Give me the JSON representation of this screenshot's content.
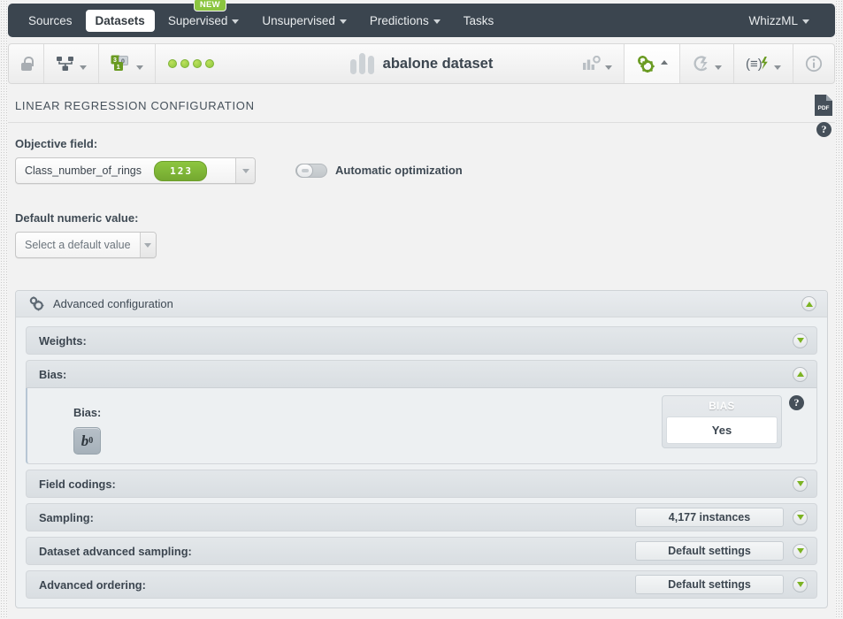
{
  "nav": {
    "items": [
      {
        "label": "Sources",
        "dropdown": false,
        "active": false
      },
      {
        "label": "Datasets",
        "dropdown": false,
        "active": true
      },
      {
        "label": "Supervised",
        "dropdown": true,
        "active": false,
        "badge": "NEW"
      },
      {
        "label": "Unsupervised",
        "dropdown": true,
        "active": false
      },
      {
        "label": "Predictions",
        "dropdown": true,
        "active": false
      },
      {
        "label": "Tasks",
        "dropdown": false,
        "active": false
      }
    ],
    "account": {
      "label": "WhizzML",
      "dropdown": true
    }
  },
  "resource_bar": {
    "title": "abalone dataset",
    "lock_icon": "lock-icon",
    "left_tools": [
      {
        "name": "dataset-tree-icon",
        "dropdown": true
      },
      {
        "name": "field-counts-icon",
        "dropdown": true,
        "counts": [
          "3",
          "0",
          "1"
        ]
      }
    ],
    "status_dots": 4,
    "right_tools": [
      {
        "name": "chart-config-icon",
        "dropdown": true,
        "active": false
      },
      {
        "name": "gears-icon",
        "dropdown": true,
        "active": true
      },
      {
        "name": "flash-icon",
        "dropdown": true,
        "active": false
      },
      {
        "name": "batch-prediction-icon",
        "dropdown": true,
        "active": false
      },
      {
        "name": "info-icon",
        "dropdown": false,
        "active": false
      }
    ]
  },
  "page": {
    "section_title": "LINEAR REGRESSION CONFIGURATION",
    "pdf_icon": "pdf-icon",
    "help_icon": "help-icon",
    "objective": {
      "label": "Objective field:",
      "value": "Class_number_of_rings",
      "type_badge": "123"
    },
    "automatic_optimization": {
      "label": "Automatic optimization",
      "enabled": false
    },
    "default_numeric": {
      "label": "Default numeric value:",
      "placeholder": "Select a default value",
      "value": ""
    },
    "advanced": {
      "title": "Advanced configuration",
      "icon": "gears-icon",
      "expanded": true,
      "panels": [
        {
          "label": "Weights:",
          "expanded": false,
          "value": ""
        },
        {
          "label": "Bias:",
          "expanded": true,
          "value": ""
        },
        {
          "label": "Field codings:",
          "expanded": false,
          "value": ""
        },
        {
          "label": "Sampling:",
          "expanded": false,
          "value": "4,177 instances"
        },
        {
          "label": "Dataset advanced sampling:",
          "expanded": false,
          "value": "Default settings"
        },
        {
          "label": "Advanced ordering:",
          "expanded": false,
          "value": "Default settings"
        }
      ],
      "bias_panel": {
        "label": "Bias:",
        "button_glyph": "b",
        "button_sub": "0",
        "card_header": "BIAS",
        "card_value": "Yes",
        "help_icon": "help-icon"
      }
    }
  },
  "colors": {
    "nav_background": "#3b454f",
    "accent_green": "#8bc53f",
    "panel_background": "#eef1f3",
    "page_background": "#f2f2f2",
    "text_dark": "#3c4650"
  }
}
